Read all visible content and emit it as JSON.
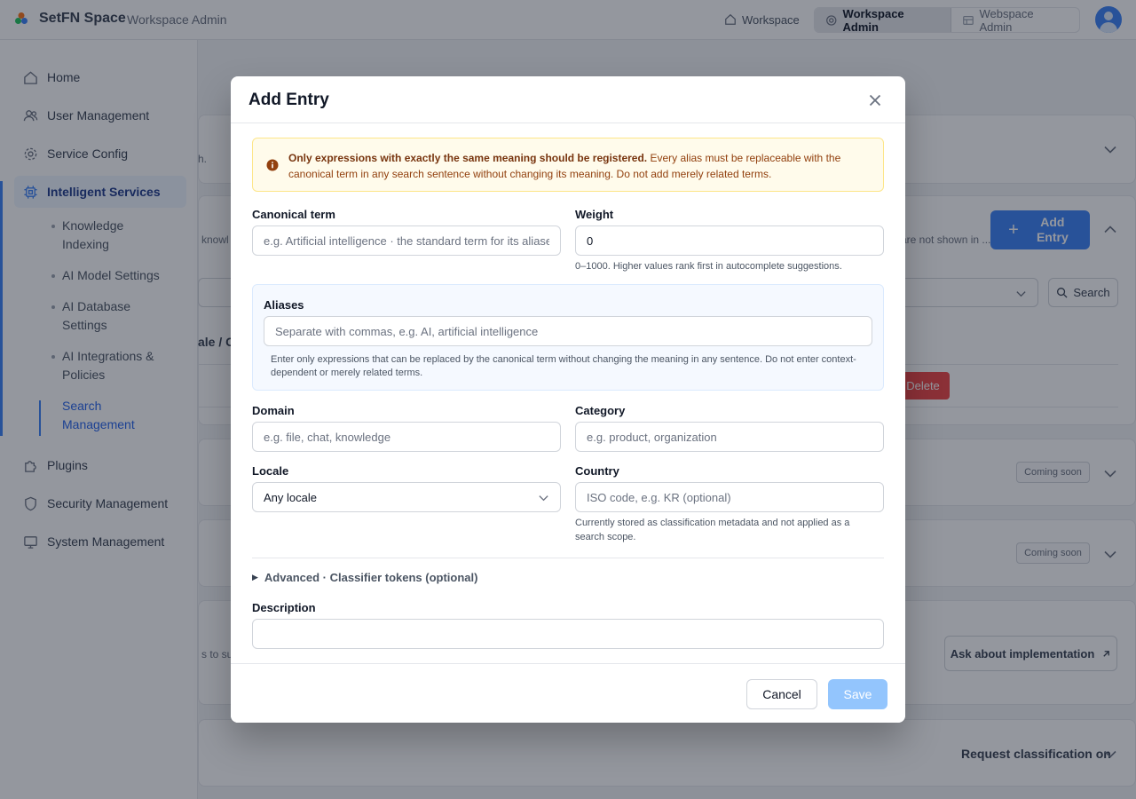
{
  "topbar": {
    "brand": "SetFN Space",
    "subtitle": "Workspace Admin",
    "nav_workspace": "Workspace",
    "seg_active": "Workspace Admin",
    "seg_other": "Webspace Admin"
  },
  "sidebar": {
    "items": [
      {
        "label": "Home",
        "icon": "home-icon"
      },
      {
        "label": "User Management",
        "icon": "users-icon"
      },
      {
        "label": "Service Config",
        "icon": "gear-icon"
      },
      {
        "label": "Intelligent Services",
        "icon": "chip-icon"
      },
      {
        "label": "Plugins",
        "icon": "puzzle-icon"
      },
      {
        "label": "Security Management",
        "icon": "shield-icon"
      },
      {
        "label": "System Management",
        "icon": "monitor-icon"
      }
    ],
    "sub_items": [
      {
        "label": "Knowledge Indexing"
      },
      {
        "label": "AI Model Settings"
      },
      {
        "label": "AI Database Settings"
      },
      {
        "label": "AI Integrations & Policies"
      },
      {
        "label": "Search Management"
      }
    ]
  },
  "background": {
    "card1_text": "h.",
    "card2_text_left": "knowl",
    "card2_text_right": "are not shown in ...",
    "add_entry_label": "Add Entry",
    "search_label": "Search",
    "col_header": "ale / C",
    "delete_label": "Delete",
    "coming_soon_1": "Coming soon",
    "coming_soon_2": "Coming soon",
    "card_text_sup": "s to sup",
    "ask_label": "Ask about implementation",
    "request_label": "Request classification on"
  },
  "modal": {
    "title": "Add Entry",
    "alert_strong": "Only expressions with exactly the same meaning should be registered.",
    "alert_text": " Every alias must be replaceable with the canonical term in any search sentence without changing its meaning. Do not add merely related terms.",
    "canonical_label": "Canonical term",
    "canonical_placeholder": "e.g. Artificial intelligence · the standard term for its aliases",
    "weight_label": "Weight",
    "weight_value": "0",
    "weight_help": "0–1000. Higher values rank first in autocomplete suggestions.",
    "aliases_label": "Aliases",
    "aliases_placeholder": "Separate with commas, e.g. AI, artificial intelligence",
    "aliases_help": "Enter only expressions that can be replaced by the canonical term without changing the meaning in any sentence. Do not enter context-dependent or merely related terms.",
    "domain_label": "Domain",
    "domain_placeholder": "e.g. file, chat, knowledge",
    "category_label": "Category",
    "category_placeholder": "e.g. product, organization",
    "locale_label": "Locale",
    "locale_value": "Any locale",
    "country_label": "Country",
    "country_placeholder": "ISO code, e.g. KR (optional)",
    "country_help": "Currently stored as classification metadata and not applied as a search scope.",
    "advanced_label": "Advanced · Classifier tokens (optional)",
    "description_label": "Description",
    "cancel_label": "Cancel",
    "save_label": "Save"
  },
  "colors": {
    "accent": "#3b82f6",
    "alert_bg": "#fffbeb",
    "alert_text": "#92400e",
    "save_disabled": "#93c5fd",
    "delete": "#ef4444"
  }
}
